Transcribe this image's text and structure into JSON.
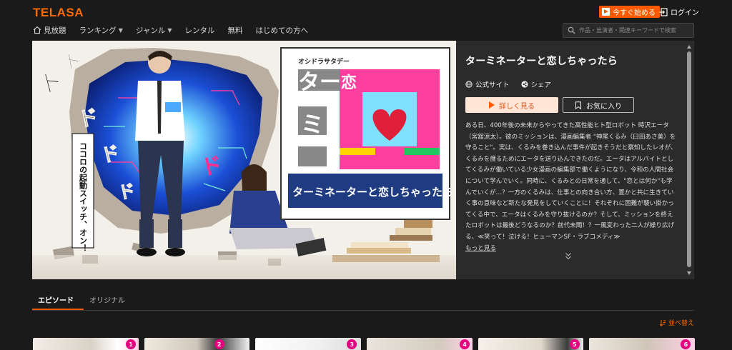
{
  "header": {
    "logo": "TELASA",
    "start_label": "今すぐ始める",
    "login_label": "ログイン"
  },
  "nav": {
    "items": [
      {
        "label": "見放題",
        "icon": "home-icon"
      },
      {
        "label": "ランキング",
        "caret": "▼"
      },
      {
        "label": "ジャンル",
        "caret": "▼"
      },
      {
        "label": "レンタル"
      },
      {
        "label": "無料"
      },
      {
        "label": "はじめての方へ"
      }
    ]
  },
  "search": {
    "placeholder": "作品・出演者・関連キーワードで検索"
  },
  "key_visual": {
    "show_badge": "オシドラサタデー",
    "logo_line1": "ター",
    "logo_line2": "ミ",
    "logo_main": "恋",
    "logo_subtitle": "ターミネーターと恋しちゃったら",
    "catchphrase": "ココロの起動スイッチ、オン！",
    "sfx": [
      "ド",
      "ド",
      "ド",
      "ド",
      "ド",
      "ド"
    ]
  },
  "detail": {
    "title": "ターミネーターと恋しちゃったら",
    "official_site_label": "公式サイト",
    "share_label": "シェア",
    "detail_button": "詳しく見る",
    "favorite_button": "お気に入り",
    "description": "ある日、400年後の未来からやってきた高性能ヒト型ロボット 時沢エータ（宮舘涼太）。彼のミッションは、漫画編集者 \"神尾くるみ（臼田あさ美）を守ること\"。実は、くるみを巻き込んだ事件が起きそうだと察知したレオが、くるみを護るためにエータを送り込んできたのだ。エータはアルバイトとしてくるみが働いている少女漫画の編集部で働くようになり、令和の人間社会について学んでいく。同時に、くるみとの日常を通して、\"恋とは何か\"も学んでいくが…？一方のくるみは、仕事との向き合い方、置かと共に生きていく事の意味など新たな発見をしていくことに！それぞれに困難が襲い掛かってくる中で、エータはくるみを守り抜けるのか？そして、ミッションを終えたロボットは最後どうなるのか？前代未聞！？一風変わった二人が繰り広げる、≪笑って！泣ける！ヒューマンSF・ラブコメディ≫",
    "more_label": "もっと見る"
  },
  "tabs": [
    {
      "label": "エピソード",
      "active": true
    },
    {
      "label": "オリジナル",
      "active": false
    }
  ],
  "sort_label": "並べ替え",
  "episodes": [
    {
      "number": "1"
    },
    {
      "number": "2"
    },
    {
      "number": "3"
    },
    {
      "number": "4"
    },
    {
      "number": "5"
    },
    {
      "number": "6"
    }
  ],
  "colors": {
    "accent": "#ff5a00",
    "background": "#1a1a1a",
    "panel": "#2b2b2b",
    "logo_pink": "#e4007f",
    "logo_cyan": "#00b4d8",
    "banner_blue": "#2c3e7c"
  }
}
